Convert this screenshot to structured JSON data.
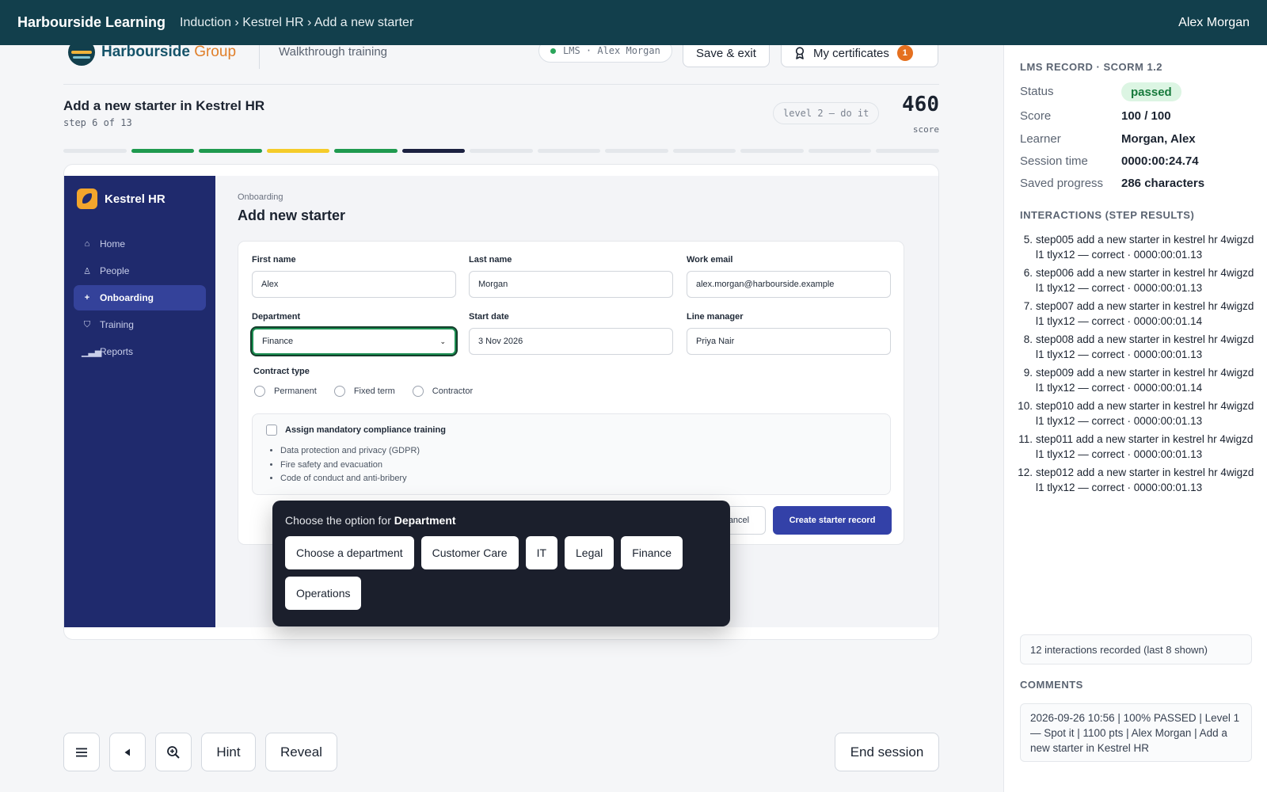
{
  "topbar": {
    "brand": "Harbourside Learning",
    "breadcrumb": "Induction › Kestrel HR › Add a new starter",
    "user": "Alex Morgan"
  },
  "lesson": {
    "org_name": "Harbourside",
    "org_suffix": "Group",
    "mode": "Walkthrough training",
    "lms_pill": "LMS · Alex Morgan",
    "save_exit": "Save & exit",
    "certificates": "My certificates",
    "certificates_count": "1",
    "title": "Add a new starter in Kestrel HR",
    "step": "step 6 of 13",
    "level": "level 2 — do it",
    "score": "460",
    "score_label": "score",
    "progress": [
      "empty",
      "green",
      "green",
      "yellow",
      "green",
      "current",
      "empty",
      "empty",
      "empty",
      "empty",
      "empty",
      "empty",
      "empty"
    ],
    "progress_colors": {
      "empty": "#e4e7eb",
      "green": "#1f9a4f",
      "yellow": "#f5cc2a",
      "current": "#1b2140"
    }
  },
  "app": {
    "name": "Kestrel HR",
    "nav": [
      {
        "label": "Home",
        "icon": "home-icon",
        "glyph": "⌂",
        "active": false
      },
      {
        "label": "People",
        "icon": "person-icon",
        "glyph": "♙",
        "active": false
      },
      {
        "label": "Onboarding",
        "icon": "plus-icon",
        "glyph": "+",
        "active": true
      },
      {
        "label": "Training",
        "icon": "graduation-cap-icon",
        "glyph": "⛉",
        "active": false
      },
      {
        "label": "Reports",
        "icon": "bar-chart-icon",
        "glyph": "▁▃▅",
        "active": false
      }
    ],
    "breadcrumb": "Onboarding",
    "page_title": "Add new starter",
    "form": {
      "first_name_label": "First name",
      "first_name": "Alex",
      "last_name_label": "Last name",
      "last_name": "Morgan",
      "email_label": "Work email",
      "email": "alex.morgan@harbourside.example",
      "department_label": "Department",
      "department": "Finance",
      "start_date_label": "Start date",
      "start_date": "3 Nov 2026",
      "manager_label": "Line manager",
      "manager": "Priya Nair",
      "contract_label": "Contract type",
      "contract_options": [
        "Permanent",
        "Fixed term",
        "Contractor"
      ],
      "training_label": "Assign mandatory compliance training",
      "training_items": [
        "Data protection and privacy (GDPR)",
        "Fire safety and evacuation",
        "Code of conduct and anti-bribery"
      ],
      "cancel": "Cancel",
      "create": "Create starter record"
    }
  },
  "popover": {
    "prompt": "Choose the option for",
    "field": "Department",
    "options": [
      "Choose a department",
      "Customer Care",
      "IT",
      "Legal",
      "Finance",
      "Operations"
    ]
  },
  "controls": {
    "menu_icon": "menu-icon",
    "back_icon": "back-icon",
    "zoom_icon": "zoom-icon",
    "hint": "Hint",
    "reveal": "Reveal",
    "end": "End session"
  },
  "lms": {
    "header": "LMS RECORD · SCORM 1.2",
    "status_label": "Status",
    "status": "passed",
    "score_label": "Score",
    "score": "100 / 100",
    "learner_label": "Learner",
    "learner": "Morgan, Alex",
    "session_label": "Session time",
    "session": "0000:00:24.74",
    "progress_label": "Saved progress",
    "progress": "286 characters",
    "interactions_header": "INTERACTIONS (STEP RESULTS)",
    "interactions": [
      {
        "num": "5.",
        "text": "step005 add a new starter in kestrel hr 4wigzd l1 tlyx12 — correct · 0000:00:01.13"
      },
      {
        "num": "6.",
        "text": "step006 add a new starter in kestrel hr 4wigzd l1 tlyx12 — correct · 0000:00:01.13"
      },
      {
        "num": "7.",
        "text": "step007 add a new starter in kestrel hr 4wigzd l1 tlyx12 — correct · 0000:00:01.14"
      },
      {
        "num": "8.",
        "text": "step008 add a new starter in kestrel hr 4wigzd l1 tlyx12 — correct · 0000:00:01.13"
      },
      {
        "num": "9.",
        "text": "step009 add a new starter in kestrel hr 4wigzd l1 tlyx12 — correct · 0000:00:01.14"
      },
      {
        "num": "10.",
        "text": "step010 add a new starter in kestrel hr 4wigzd l1 tlyx12 — correct · 0000:00:01.13"
      },
      {
        "num": "11.",
        "text": "step011 add a new starter in kestrel hr 4wigzd l1 tlyx12 — correct · 0000:00:01.13"
      },
      {
        "num": "12.",
        "text": "step012 add a new starter in kestrel hr 4wigzd l1 tlyx12 — correct · 0000:00:01.13"
      }
    ],
    "interactions_note": "12 interactions recorded (last 8 shown)",
    "comments_header": "COMMENTS",
    "comment": "2026-09-26 10:56 | 100% PASSED | Level 1 — Spot it | 1100 pts | Alex Morgan | Add a new starter in Kestrel HR"
  }
}
